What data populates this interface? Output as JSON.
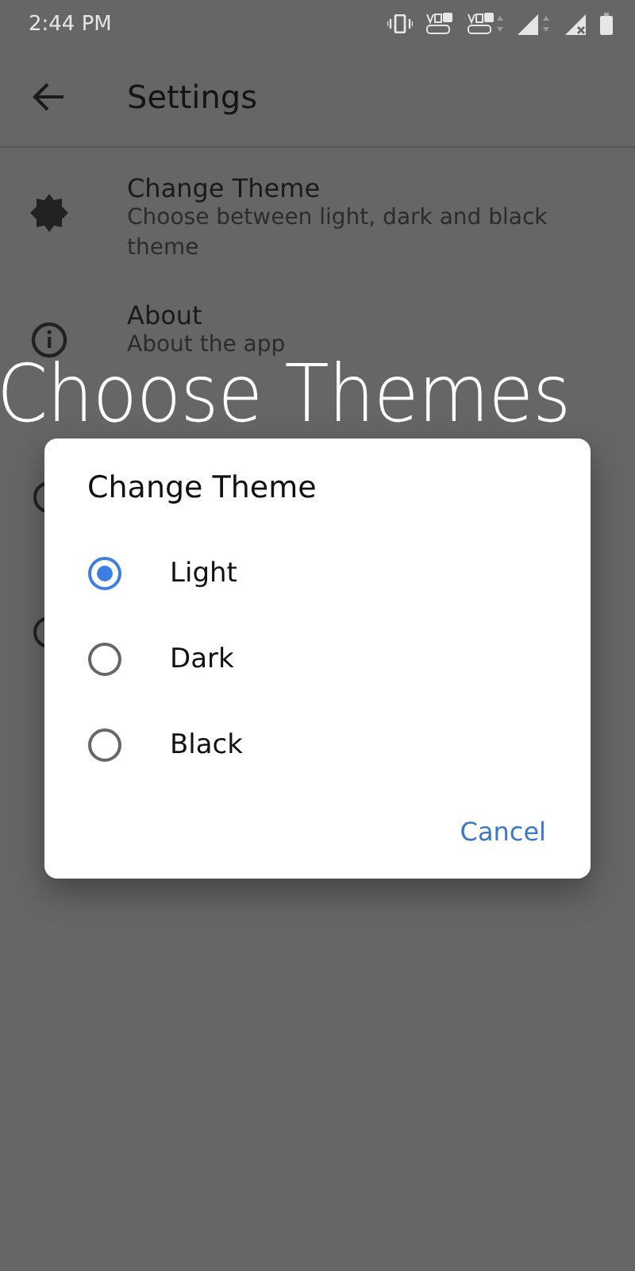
{
  "status_bar": {
    "time": "2:44 PM"
  },
  "app_bar": {
    "title": "Settings"
  },
  "settings": [
    {
      "kind": "theme",
      "title": "Change Theme",
      "subtitle": "Choose between light, dark and black theme"
    },
    {
      "kind": "info",
      "title": "About",
      "subtitle": "About the app"
    }
  ],
  "caption": "Choose Themes",
  "dialog": {
    "title": "Change Theme",
    "options": [
      {
        "label": "Light",
        "selected": true
      },
      {
        "label": "Dark",
        "selected": false
      },
      {
        "label": "Black",
        "selected": false
      }
    ],
    "buttons": [
      "Cancel"
    ]
  }
}
